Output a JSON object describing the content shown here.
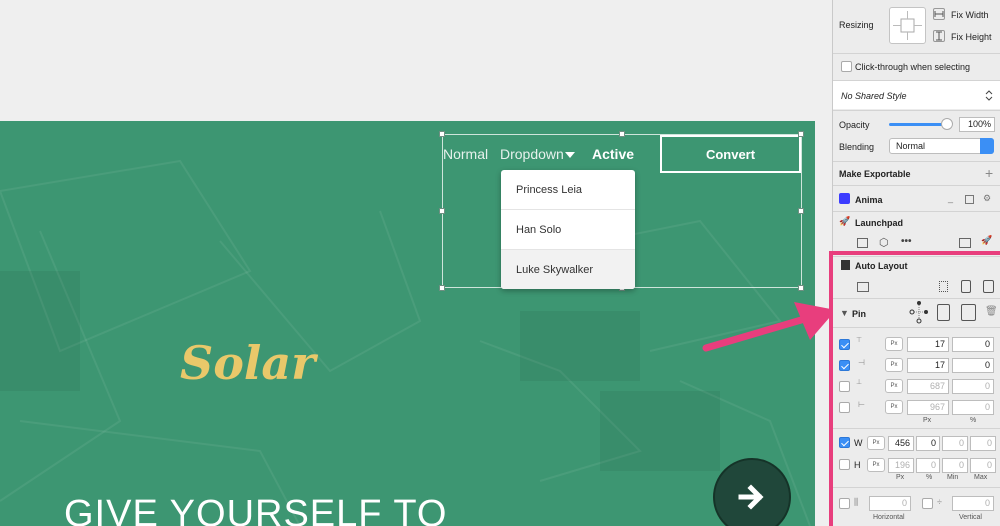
{
  "artboard": {
    "nav": {
      "normal": "Normal",
      "dropdown": "Dropdown",
      "active": "Active"
    },
    "convert_label": "Convert",
    "dropdown_items": [
      "Princess Leia",
      "Han Solo",
      "Luke Skywalker"
    ],
    "logo_text": "Solar",
    "headline": "GIVE YOURSELF TO",
    "colors": {
      "background": "#3d9672",
      "logo": "#e9c86a",
      "annotation": "#e83e7d"
    }
  },
  "inspector": {
    "resizing_label": "Resizing",
    "fix_width": "Fix Width",
    "fix_height": "Fix Height",
    "click_through": "Click-through when selecting",
    "shared_style": "No Shared Style",
    "opacity_label": "Opacity",
    "opacity_value": "100%",
    "opacity_level": 1.0,
    "blending_label": "Blending",
    "blending_value": "Normal",
    "make_exportable": "Make Exportable",
    "plugin_anima": "Anima",
    "plugin_launchpad": "Launchpad",
    "auto_layout": "Auto Layout",
    "pin_label": "Pin",
    "pin_rows": [
      {
        "checked": true,
        "unit": "Px",
        "px": "17",
        "pct": "0",
        "dim": false
      },
      {
        "checked": true,
        "unit": "Px",
        "px": "17",
        "pct": "0",
        "dim": false
      },
      {
        "checked": false,
        "unit": "Px",
        "px": "687",
        "pct": "0",
        "dim": true
      },
      {
        "checked": false,
        "unit": "Px",
        "px": "967",
        "pct": "0",
        "dim": true
      }
    ],
    "col_px": "Px",
    "col_pct": "%",
    "size_rows": [
      {
        "letter": "W",
        "checked": true,
        "unit": "Px",
        "value": "456",
        "pct": "0",
        "min": "0",
        "max": "0"
      },
      {
        "letter": "H",
        "checked": false,
        "unit": "Px",
        "value": "196",
        "pct": "0",
        "min": "0",
        "max": "0"
      }
    ],
    "size_cols": {
      "px": "Px",
      "pct": "%",
      "min": "Min",
      "max": "Max"
    },
    "horizontal_value": "0",
    "vertical_value": "0",
    "horizontal_label": "Horizontal",
    "vertical_label": "Vertical"
  }
}
